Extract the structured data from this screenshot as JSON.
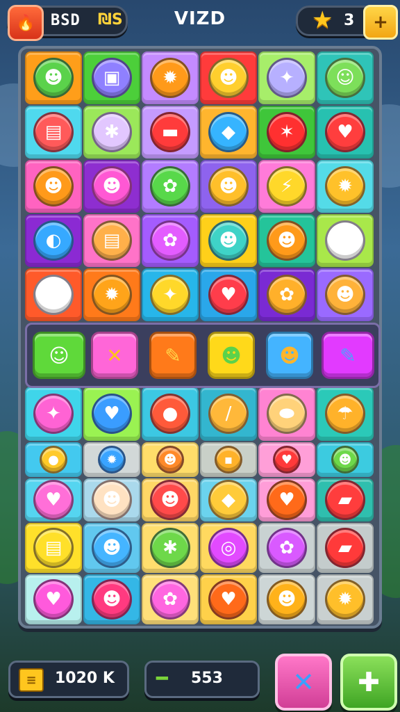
{
  "header": {
    "left_value": "BSD",
    "left_coin": "₪S",
    "title": "VIZD",
    "right_value": "3",
    "plus": "+",
    "left_icon": "fire-gem-icon",
    "right_icon": "star-icon"
  },
  "board": {
    "rows": [
      [
        {
          "bg": "#ff9e1a",
          "icon": "#5bd24b",
          "glyph": "☻"
        },
        {
          "bg": "#4ccf3a",
          "icon": "#8f80ff",
          "glyph": "▣"
        },
        {
          "bg": "#c48bff",
          "icon": "#ff9a1a",
          "glyph": "✹"
        },
        {
          "bg": "#ff3b3b",
          "icon": "#ffcf2e",
          "glyph": "☻"
        },
        {
          "bg": "#a7ee6a",
          "icon": "#b7b0ff",
          "glyph": "✦"
        },
        {
          "bg": "#2fc4b8",
          "icon": "#7ddf5a",
          "glyph": "☺"
        }
      ],
      [
        {
          "bg": "#4fd9ee",
          "icon": "#ff5a5a",
          "glyph": "▤"
        },
        {
          "bg": "#9be85a",
          "icon": "#e2c7ff",
          "glyph": "✱"
        },
        {
          "bg": "#c59bff",
          "icon": "#ff3b3b",
          "glyph": "▬"
        },
        {
          "bg": "#ffb52e",
          "icon": "#36b4ff",
          "glyph": "◆"
        },
        {
          "bg": "#3fc63a",
          "icon": "#ff3030",
          "glyph": "✶"
        },
        {
          "bg": "#27c1b0",
          "icon": "#ff3e3e",
          "glyph": "♥"
        }
      ],
      [
        {
          "bg": "#ff63c0",
          "icon": "#ff9a1a",
          "glyph": "☻"
        },
        {
          "bg": "#8e2ed0",
          "icon": "#ff58d4",
          "glyph": "☻"
        },
        {
          "bg": "#b37cff",
          "icon": "#58d84a",
          "glyph": "✿"
        },
        {
          "bg": "#8e63ee",
          "icon": "#ffbf2a",
          "glyph": "☻"
        },
        {
          "bg": "#ff7bd9",
          "icon": "#ffd82a",
          "glyph": "⚡"
        },
        {
          "bg": "#54dbe8",
          "icon": "#ffc12a",
          "glyph": "✹"
        }
      ],
      [
        {
          "bg": "#8b2ad3",
          "icon": "#36a9ff",
          "glyph": "◐"
        },
        {
          "bg": "#ff73c8",
          "icon": "#ffb04a",
          "glyph": "▤"
        },
        {
          "bg": "#a45cff",
          "icon": "#e35cff",
          "glyph": "✿"
        },
        {
          "bg": "#ffd01a",
          "icon": "#3fd3c7",
          "glyph": "☻"
        },
        {
          "bg": "#24c49a",
          "icon": "#ff9a1a",
          "glyph": "☻"
        },
        {
          "bg": "#a9e84a",
          "icon": "#ffffff",
          "glyph": "✦"
        }
      ],
      [
        {
          "bg": "#ff5a2a",
          "icon": "#ffffff",
          "glyph": "◉"
        },
        {
          "bg": "#ff7a1a",
          "icon": "#ffa41a",
          "glyph": "✹"
        },
        {
          "bg": "#27b6ea",
          "icon": "#ffd82a",
          "glyph": "✦"
        },
        {
          "bg": "#2aa7ea",
          "icon": "#ff3d4b",
          "glyph": "♥"
        },
        {
          "bg": "#7a2ad3",
          "icon": "#ffb02a",
          "glyph": "✿"
        },
        {
          "bg": "#9a6aff",
          "icon": "#ffb23a",
          "glyph": "☻"
        }
      ],
      [
        {
          "bg": "#3fd5ea",
          "icon": "#ff63d4",
          "glyph": "✦"
        },
        {
          "bg": "#9af252",
          "icon": "#3a9dff",
          "glyph": "♥"
        },
        {
          "bg": "#3cc8e3",
          "icon": "#ff5a3a",
          "glyph": "●"
        },
        {
          "bg": "#33b6cf",
          "icon": "#ffb83a",
          "glyph": "/"
        },
        {
          "bg": "#ff83d2",
          "icon": "#ffd27a",
          "glyph": "⬬"
        },
        {
          "bg": "#2bc9b8",
          "icon": "#ffb22a",
          "glyph": "☂"
        }
      ],
      [
        {
          "bg": "#43c9ef",
          "icon": "#ffca2a",
          "glyph": "●"
        },
        {
          "bg": "#d2d8d8",
          "icon": "#3aa4ff",
          "glyph": "✹"
        },
        {
          "bg": "#ffdd6a",
          "icon": "#ff8a2a",
          "glyph": "☻"
        },
        {
          "bg": "#c9d0c8",
          "icon": "#ffb22a",
          "glyph": "▪"
        },
        {
          "bg": "#ff9fd8",
          "icon": "#ff3a3a",
          "glyph": "♥"
        },
        {
          "bg": "#3ccbe0",
          "icon": "#6ed84a",
          "glyph": "☻"
        }
      ],
      [
        {
          "bg": "#55d5f0",
          "icon": "#ff6fd8",
          "glyph": "♥"
        },
        {
          "bg": "#aad9ec",
          "icon": "#ffe2c2",
          "glyph": "☻"
        },
        {
          "bg": "#ffd766",
          "icon": "#ff4a4a",
          "glyph": "☻"
        },
        {
          "bg": "#6bd3ee",
          "icon": "#ffcb3a",
          "glyph": "◆"
        },
        {
          "bg": "#ff9dd8",
          "icon": "#ff6a1a",
          "glyph": "♥"
        },
        {
          "bg": "#2fbfae",
          "icon": "#ff3d3d",
          "glyph": "▰"
        }
      ],
      [
        {
          "bg": "#ffe02a",
          "icon": "#ffe02a",
          "glyph": "▤"
        },
        {
          "bg": "#61c8ef",
          "icon": "#45b5ff",
          "glyph": "☻"
        },
        {
          "bg": "#ffde6e",
          "icon": "#6ed84a",
          "glyph": "✱"
        },
        {
          "bg": "#ffd95f",
          "icon": "#e24aff",
          "glyph": "◎"
        },
        {
          "bg": "#c9d2d2",
          "icon": "#d95aff",
          "glyph": "✿"
        },
        {
          "bg": "#c4cccc",
          "icon": "#ff3a3a",
          "glyph": "▰"
        }
      ],
      [
        {
          "bg": "#b8f0ee",
          "icon": "#ff5adc",
          "glyph": "♥"
        },
        {
          "bg": "#34b7e6",
          "icon": "#ff3a80",
          "glyph": "☻"
        },
        {
          "bg": "#ffe07a",
          "icon": "#ff66e0",
          "glyph": "✿"
        },
        {
          "bg": "#ffd14a",
          "icon": "#ff6a1a",
          "glyph": "♥"
        },
        {
          "bg": "#cdd6d6",
          "icon": "#ffb21a",
          "glyph": "☻"
        },
        {
          "bg": "#c9d0d0",
          "icon": "#ffbf2a",
          "glyph": "✹"
        }
      ]
    ],
    "special_row": [
      {
        "bg": "#5fd93a",
        "glyph": "☺",
        "color": "#fff"
      },
      {
        "bg": "#ff66d8",
        "glyph": "✕",
        "color": "#ffc21a"
      },
      {
        "bg": "#ff7a1a",
        "glyph": "✎",
        "color": "#ffd64a"
      },
      {
        "bg": "#ffd91a",
        "glyph": "☻",
        "color": "#5bd24b"
      },
      {
        "bg": "#44b4ff",
        "glyph": "☻",
        "color": "#ffb52a"
      },
      {
        "bg": "#e23aff",
        "glyph": "✎",
        "color": "#4aa2ff"
      }
    ]
  },
  "footer": {
    "score_value": "1020 K",
    "bone_value": "553",
    "menu_glyph": "≡",
    "bone_glyph": "🦴",
    "x_glyph": "✕",
    "plus_glyph": "✚"
  }
}
